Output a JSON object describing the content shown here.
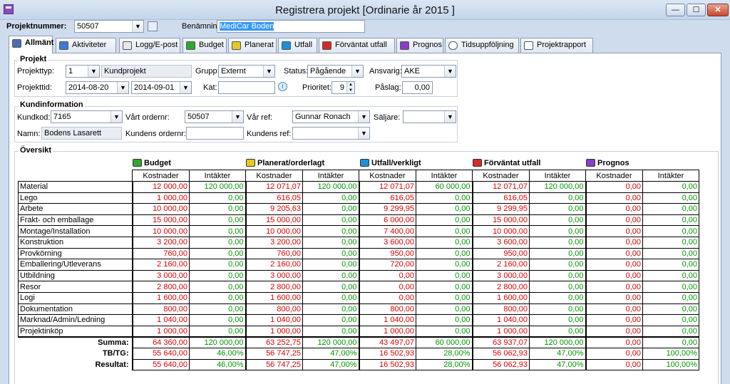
{
  "window": {
    "title": "Registrera projekt [Ordinarie år 2015 ]",
    "min": "—",
    "max": "☐",
    "close": "✕"
  },
  "top": {
    "projnr_label": "Projektnummer:",
    "projnr_value": "50507",
    "benamning_label": "Benämning",
    "benamning_value": "MediCar Boden"
  },
  "tabs": [
    {
      "label": "Allmänt",
      "color": "#4a6fb5"
    },
    {
      "label": "Aktiviteter",
      "color": "#3c7ad6"
    },
    {
      "label": "Logg/E-post",
      "color": "#e8e8e8"
    },
    {
      "label": "Budget",
      "color": "#2fa82f"
    },
    {
      "label": "Planerat",
      "color": "#e6c823"
    },
    {
      "label": "Utfall",
      "color": "#1f8fd6"
    },
    {
      "label": "Förväntat utfall",
      "color": "#d42a2a"
    },
    {
      "label": "Prognos",
      "color": "#8a3cc8"
    },
    {
      "label": "Tidsuppföljning",
      "color": "#ffffff"
    },
    {
      "label": "Projektrapport",
      "color": "#ffffff"
    }
  ],
  "projekt": {
    "title": "Projekt",
    "typ_label": "Projekttyp:",
    "typ_value": "1",
    "typ_name": "Kundprojekt",
    "grupp_label": "Grupp:",
    "grupp_value": "Externt",
    "status_label": "Status:",
    "status_value": "Pågående",
    "ansvarig_label": "Ansvarig:",
    "ansvarig_value": "AKE",
    "tid_label": "Projekttid:",
    "tid_from": "2014-08-20",
    "tid_to": "2014-09-01",
    "kat_label": "Kat:",
    "kat_value": "",
    "prio_label": "Prioritet:",
    "prio_value": "9",
    "paslag_label": "Påslag:",
    "paslag_value": "0,00"
  },
  "kund": {
    "title": "Kundinformation",
    "kod_label": "Kundkod:",
    "kod_value": "7165",
    "ordernr_label": "Vårt ordernr:",
    "ordernr_value": "50507",
    "ref_label": "Vår ref:",
    "ref_value": "Gunnar Ronach",
    "saljare_label": "Säljare:",
    "saljare_value": "",
    "namn_label": "Namn:",
    "namn_value": "Bodens Lasarett",
    "kundorder_label": "Kundens ordernr:",
    "kundorder_value": "",
    "kundref_label": "Kundens ref:",
    "kundref_value": ""
  },
  "oversikt": {
    "title": "Översikt",
    "groups": [
      {
        "label": "Budget",
        "color": "#2fa82f"
      },
      {
        "label": "Planerat/orderlagt",
        "color": "#e6c823"
      },
      {
        "label": "Utfall/verkligt",
        "color": "#1f8fd6"
      },
      {
        "label": "Förväntat utfall",
        "color": "#d42a2a"
      },
      {
        "label": "Prognos",
        "color": "#8a3cc8"
      }
    ],
    "col_k": "Kostnader",
    "col_i": "Intäkter",
    "rows": [
      {
        "label": "Material",
        "v": [
          "12 000,00",
          "120 000,00",
          "12 071,07",
          "120 000,00",
          "12 071,07",
          "60 000,00",
          "12 071,07",
          "120 000,00",
          "0,00",
          "0,00"
        ]
      },
      {
        "label": "Lego",
        "v": [
          "1 000,00",
          "0,00",
          "616,05",
          "0,00",
          "616,05",
          "0,00",
          "616,05",
          "0,00",
          "0,00",
          "0,00"
        ]
      },
      {
        "label": "Arbete",
        "v": [
          "10 000,00",
          "0,00",
          "9 205,63",
          "0,00",
          "9 299,95",
          "0,00",
          "9 299,95",
          "0,00",
          "0,00",
          "0,00"
        ]
      },
      {
        "label": "Frakt- och emballage",
        "v": [
          "15 000,00",
          "0,00",
          "15 000,00",
          "0,00",
          "6 000,00",
          "0,00",
          "15 000,00",
          "0,00",
          "0,00",
          "0,00"
        ]
      },
      {
        "label": "Montage/Installation",
        "v": [
          "10 000,00",
          "0,00",
          "10 000,00",
          "0,00",
          "7 400,00",
          "0,00",
          "10 000,00",
          "0,00",
          "0,00",
          "0,00"
        ]
      },
      {
        "label": "Konstruktion",
        "v": [
          "3 200,00",
          "0,00",
          "3 200,00",
          "0,00",
          "3 600,00",
          "0,00",
          "3 600,00",
          "0,00",
          "0,00",
          "0,00"
        ]
      },
      {
        "label": "Provkörning",
        "v": [
          "760,00",
          "0,00",
          "760,00",
          "0,00",
          "950,00",
          "0,00",
          "950,00",
          "0,00",
          "0,00",
          "0,00"
        ]
      },
      {
        "label": "Emballering/Utleverans",
        "v": [
          "2 160,00",
          "0,00",
          "2 160,00",
          "0,00",
          "720,00",
          "0,00",
          "2 160,00",
          "0,00",
          "0,00",
          "0,00"
        ]
      },
      {
        "label": "Utbildning",
        "v": [
          "3 000,00",
          "0,00",
          "3 000,00",
          "0,00",
          "0,00",
          "0,00",
          "3 000,00",
          "0,00",
          "0,00",
          "0,00"
        ]
      },
      {
        "label": "Resor",
        "v": [
          "2 800,00",
          "0,00",
          "2 800,00",
          "0,00",
          "0,00",
          "0,00",
          "2 800,00",
          "0,00",
          "0,00",
          "0,00"
        ]
      },
      {
        "label": "Logi",
        "v": [
          "1 600,00",
          "0,00",
          "1 600,00",
          "0,00",
          "0,00",
          "0,00",
          "1 600,00",
          "0,00",
          "0,00",
          "0,00"
        ]
      },
      {
        "label": "Dokumentation",
        "v": [
          "800,00",
          "0,00",
          "800,00",
          "0,00",
          "800,00",
          "0,00",
          "800,00",
          "0,00",
          "0,00",
          "0,00"
        ]
      },
      {
        "label": "Marknad/Admin/Ledning",
        "v": [
          "1 040,00",
          "0,00",
          "1 040,00",
          "0,00",
          "1 040,00",
          "0,00",
          "1 040,00",
          "0,00",
          "0,00",
          "0,00"
        ]
      },
      {
        "label": "Projektinköp",
        "v": [
          "1 000,00",
          "0,00",
          "1 000,00",
          "0,00",
          "1 000,00",
          "0,00",
          "1 000,00",
          "0,00",
          "0,00",
          "0,00"
        ]
      }
    ],
    "summary": [
      {
        "label": "Summa:",
        "v": [
          "64 360,00",
          "120 000,00",
          "63 252,75",
          "120 000,00",
          "43 497,07",
          "60 000,00",
          "63 937,07",
          "120 000,00",
          "0,00",
          "0,00"
        ]
      },
      {
        "label": "TB/TG:",
        "v": [
          "55 640,00",
          "46,00%",
          "56 747,25",
          "47,00%",
          "16 502,93",
          "28,00%",
          "56 062,93",
          "47,00%",
          "0,00",
          "100,00%"
        ]
      },
      {
        "label": "Resultat:",
        "v": [
          "55 640,00",
          "46,00%",
          "56 747,25",
          "47,00%",
          "16 502,93",
          "28,00%",
          "56 062,93",
          "47,00%",
          "0,00",
          "100,00%"
        ]
      }
    ]
  }
}
